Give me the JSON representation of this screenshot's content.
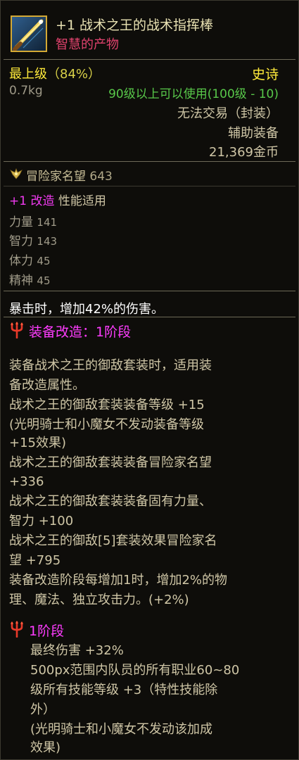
{
  "item": {
    "name": "+1 战术之王的战术指挥棒",
    "subtitle": "智慧的产物",
    "grade": "最上级",
    "grade_percent": "（84%）",
    "rarity": "史诗",
    "weight": "0.7kg",
    "level_requirement": "90级以上可以使用(100级 - 10)",
    "trade_status": "无法交易（封装）",
    "category": "辅助装备",
    "price": "21,369金币"
  },
  "fame": {
    "label": "冒险家名望",
    "value": "643"
  },
  "refine": {
    "label": "+1 改造",
    "note": "性能适用"
  },
  "stats": [
    {
      "name": "力量",
      "value": "141"
    },
    {
      "name": "智力",
      "value": "143"
    },
    {
      "name": "体力",
      "value": "45"
    },
    {
      "name": "精神",
      "value": "45"
    }
  ],
  "crit_effect": "暴击时，增加42%的伤害。",
  "amplify": {
    "title": "装备改造：1阶段",
    "lines": [
      "装备战术之王的御敌套装时，适用装",
      "备改造属性。",
      "战术之王的御敌套装装备等级 +15",
      "(光明骑士和小魔女不发动装备等级",
      "+15效果)",
      "战术之王的御敌套装装备冒险家名望",
      "+336",
      "战术之王的御敌套装装备固有力量、",
      "智力 +100",
      "战术之王的御敌[5]套装效果冒险家名",
      "望 +795",
      "装备改造阶段每增加1时，增加2%的物",
      "理、魔法、独立攻击力。(+2%)"
    ]
  },
  "stage": {
    "title": "1阶段",
    "lines": [
      "最终伤害 +32%",
      "500px范围内队员的所有职业60~80",
      "级所有技能等级 +3（特性技能除",
      "外）",
      "(光明骑士和小魔女不发动该加成",
      "效果)"
    ]
  },
  "colors": {
    "epic": "#ffea3a",
    "refine": "#f03af0",
    "amplify_title": "#ff3cff",
    "subtitle": "#e0426d",
    "level_req": "#58c84a"
  }
}
